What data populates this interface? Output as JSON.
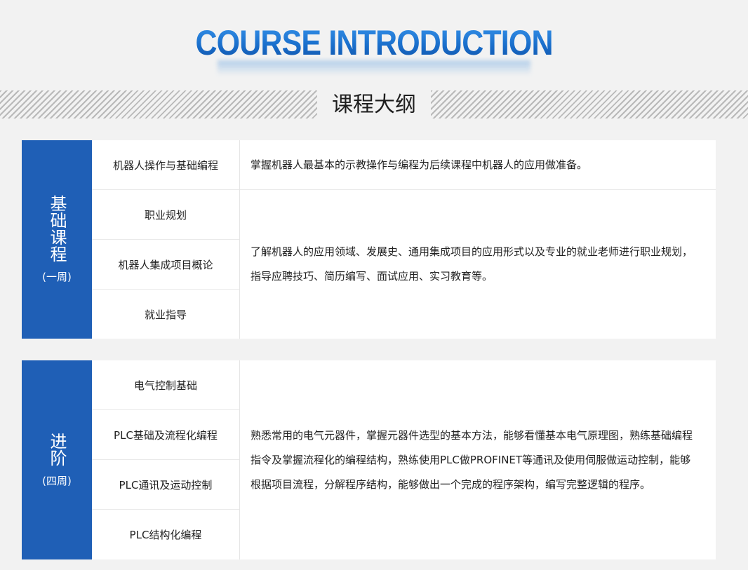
{
  "header": {
    "title_en": "COURSE INTRODUCTION",
    "title_cn": "课程大纲"
  },
  "sections": [
    {
      "name": "基础课程",
      "duration": "(一周)",
      "modules": [
        "机器人操作与基础编程",
        "职业规划",
        "机器人集成项目概论",
        "就业指导"
      ],
      "descriptions": [
        "掌握机器人最基本的示教操作与编程为后续课程中机器人的应用做准备。",
        "了解机器人的应用领域、发展史、通用集成项目的应用形式以及专业的就业老师进行职业规划，指导应聘技巧、简历编写、面试应用、实习教育等。"
      ]
    },
    {
      "name": "进阶",
      "duration": "(四周)",
      "modules": [
        "电气控制基础",
        "PLC基础及流程化编程",
        "PLC通讯及运动控制",
        "PLC结构化编程"
      ],
      "descriptions": [
        "熟悉常用的电气元器件，掌握元器件选型的基本方法，能够看懂基本电气原理图，熟练基础编程指令及掌握流程化的编程结构，熟练使用PLC做PROFINET等通讯及使用伺服做运动控制，能够根据项目流程，分解程序结构，能够做出一个完成的程序架构，编写完整逻辑的程序。"
      ]
    }
  ]
}
